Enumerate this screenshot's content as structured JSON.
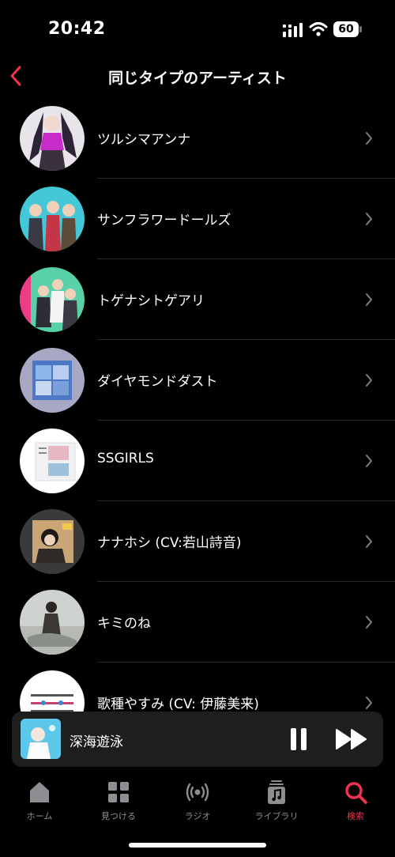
{
  "status_bar": {
    "time": "20:42",
    "battery": "60"
  },
  "nav": {
    "title": "同じタイプのアーティスト"
  },
  "artists": [
    {
      "name": "ツルシマアンナ"
    },
    {
      "name": "サンフラワードールズ"
    },
    {
      "name": "トゲナシトゲアリ"
    },
    {
      "name": "ダイヤモンドダスト"
    },
    {
      "name": "SSGIRLS"
    },
    {
      "name": "ナナホシ (CV:若山詩音)"
    },
    {
      "name": "キミのね"
    },
    {
      "name": "歌種やすみ (CV: 伊藤美来)"
    }
  ],
  "now_playing": {
    "title": "深海遊泳"
  },
  "tabs": [
    {
      "label": "ホーム",
      "icon": "home-icon"
    },
    {
      "label": "見つける",
      "icon": "grid-icon"
    },
    {
      "label": "ラジオ",
      "icon": "radio-icon"
    },
    {
      "label": "ライブラリ",
      "icon": "library-icon"
    },
    {
      "label": "検索",
      "icon": "search-icon",
      "active": true
    }
  ],
  "colors": {
    "accent": "#f3334e",
    "background": "#000000",
    "inactive": "#8d8d92"
  }
}
